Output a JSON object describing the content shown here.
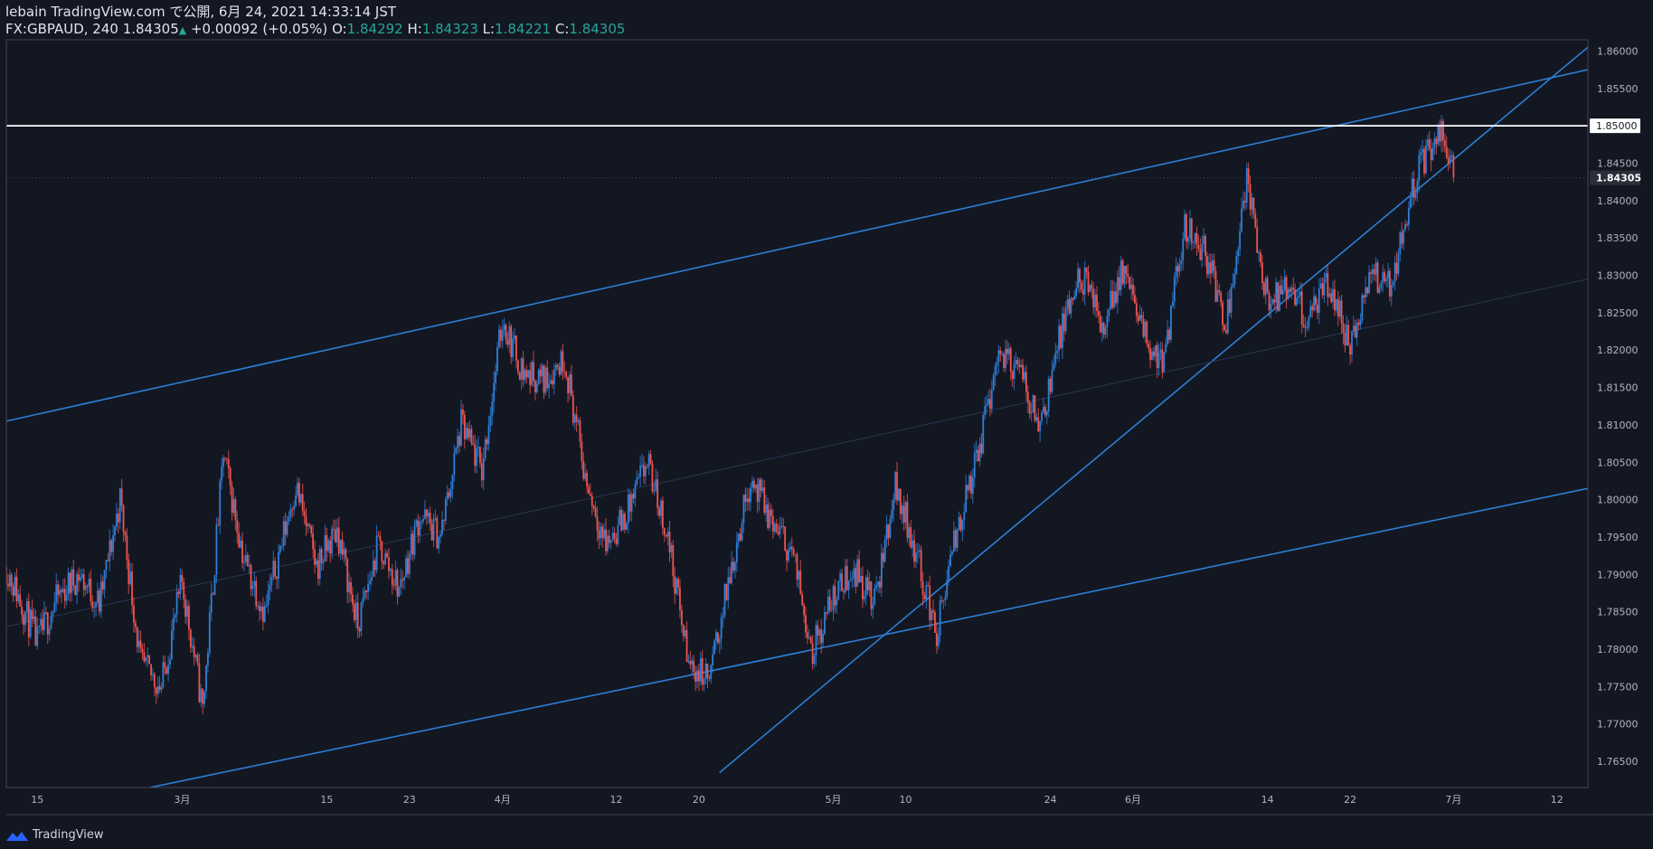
{
  "header": {
    "line1": "lebain TradingView.com で公開, 6月 24, 2021 14:33:14 JST",
    "symbol": "FX:GBPAUD, 240",
    "last": "1.84305",
    "change": "+0.00092 (+0.05%)",
    "o_label": "O:",
    "o_value": "1.84292",
    "h_label": "H:",
    "h_value": "1.84323",
    "l_label": "L:",
    "l_value": "1.84221",
    "c_label": "C:",
    "c_value": "1.84305"
  },
  "footer": {
    "brand": "TradingView"
  },
  "colors": {
    "background": "#131722",
    "up": "#2f7fd8",
    "down": "#ef5350",
    "trendline": "#2b7fd6",
    "level": "#ffffff",
    "axis_text": "#b2b5be",
    "separator": "#434651"
  },
  "chart_data": {
    "type": "candlestick",
    "symbol": "FX:GBPAUD",
    "interval": "240",
    "x_ticks": [
      "15",
      "3月",
      "15",
      "23",
      "4月",
      "12",
      "20",
      "5月",
      "10",
      "24",
      "6月",
      "14",
      "22",
      "7月",
      "12"
    ],
    "y_ticks": [
      1.86,
      1.855,
      1.85,
      1.845,
      1.84,
      1.835,
      1.83,
      1.825,
      1.82,
      1.815,
      1.81,
      1.805,
      1.8,
      1.795,
      1.79,
      1.785,
      1.78,
      1.775,
      1.77,
      1.765
    ],
    "y_tick_labels": [
      "1.86000",
      "1.85500",
      "1.85000",
      "1.84500",
      "1.84000",
      "1.83500",
      "1.83000",
      "1.82500",
      "1.82000",
      "1.81500",
      "1.81000",
      "1.80500",
      "1.80000",
      "1.79500",
      "1.79000",
      "1.78500",
      "1.78000",
      "1.77500",
      "1.77000",
      "1.76500"
    ],
    "ylim": [
      1.7615,
      1.8615
    ],
    "date_range": [
      "2021-02-12",
      "2021-07-15"
    ],
    "horizontal_line": {
      "value": 1.85,
      "label": "1.85000"
    },
    "last_price": {
      "value": 1.84305,
      "label": "1.84305"
    },
    "trendlines": [
      {
        "start": [
          "2021-02-12",
          1.8105
        ],
        "end": [
          "2021-07-15",
          1.8575
        ]
      },
      {
        "start": [
          "2021-02-12",
          1.7575
        ],
        "end": [
          "2021-07-15",
          1.8015
        ]
      },
      {
        "start": [
          "2021-04-22",
          1.7635
        ],
        "end": [
          "2021-07-15",
          1.8605
        ]
      },
      {
        "start": [
          "2021-02-12",
          1.783
        ],
        "end": [
          "2021-07-15",
          1.8295
        ],
        "style": "faint"
      }
    ],
    "price_path": [
      [
        "2021-02-12",
        1.791
      ],
      [
        "2021-02-15",
        1.781
      ],
      [
        "2021-02-17",
        1.787
      ],
      [
        "2021-02-19",
        1.79
      ],
      [
        "2021-02-21",
        1.786
      ],
      [
        "2021-02-23",
        1.8
      ],
      [
        "2021-02-25",
        1.778
      ],
      [
        "2021-02-27",
        1.775
      ],
      [
        "2021-03-01",
        1.789
      ],
      [
        "2021-03-03",
        1.772
      ],
      [
        "2021-03-05",
        1.806
      ],
      [
        "2021-03-07",
        1.792
      ],
      [
        "2021-03-09",
        1.785
      ],
      [
        "2021-03-12",
        1.802
      ],
      [
        "2021-03-14",
        1.791
      ],
      [
        "2021-03-16",
        1.796
      ],
      [
        "2021-03-18",
        1.783
      ],
      [
        "2021-03-20",
        1.794
      ],
      [
        "2021-03-22",
        1.788
      ],
      [
        "2021-03-24",
        1.798
      ],
      [
        "2021-03-26",
        1.795
      ],
      [
        "2021-03-28",
        1.81
      ],
      [
        "2021-03-30",
        1.804
      ],
      [
        "2021-04-01",
        1.824
      ],
      [
        "2021-04-03",
        1.817
      ],
      [
        "2021-04-05",
        1.816
      ],
      [
        "2021-04-07",
        1.819
      ],
      [
        "2021-04-09",
        1.803
      ],
      [
        "2021-04-11",
        1.794
      ],
      [
        "2021-04-13",
        1.798
      ],
      [
        "2021-04-15",
        1.805
      ],
      [
        "2021-04-17",
        1.795
      ],
      [
        "2021-04-19",
        1.778
      ],
      [
        "2021-04-21",
        1.776
      ],
      [
        "2021-04-23",
        1.79
      ],
      [
        "2021-04-25",
        1.803
      ],
      [
        "2021-04-27",
        1.797
      ],
      [
        "2021-04-29",
        1.793
      ],
      [
        "2021-05-01",
        1.78
      ],
      [
        "2021-05-03",
        1.787
      ],
      [
        "2021-05-05",
        1.791
      ],
      [
        "2021-05-07",
        1.786
      ],
      [
        "2021-05-09",
        1.802
      ],
      [
        "2021-05-11",
        1.793
      ],
      [
        "2021-05-13",
        1.782
      ],
      [
        "2021-05-15",
        1.796
      ],
      [
        "2021-05-17",
        1.806
      ],
      [
        "2021-05-19",
        1.82
      ],
      [
        "2021-05-21",
        1.817
      ],
      [
        "2021-05-23",
        1.81
      ],
      [
        "2021-05-25",
        1.822
      ],
      [
        "2021-05-27",
        1.83
      ],
      [
        "2021-05-29",
        1.823
      ],
      [
        "2021-05-31",
        1.831
      ],
      [
        "2021-06-02",
        1.822
      ],
      [
        "2021-06-04",
        1.818
      ],
      [
        "2021-06-06",
        1.837
      ],
      [
        "2021-06-08",
        1.833
      ],
      [
        "2021-06-10",
        1.824
      ],
      [
        "2021-06-12",
        1.843
      ],
      [
        "2021-06-14",
        1.826
      ],
      [
        "2021-06-16",
        1.828
      ],
      [
        "2021-06-18",
        1.824
      ],
      [
        "2021-06-20",
        1.829
      ],
      [
        "2021-06-22",
        1.82
      ],
      [
        "2021-06-24",
        1.83
      ],
      [
        "2021-06-26",
        1.829
      ],
      [
        "2021-06-28",
        1.842
      ],
      [
        "2021-06-30",
        1.848
      ],
      [
        "2021-07-01",
        1.849
      ],
      [
        "2021-07-02",
        1.843
      ]
    ]
  }
}
